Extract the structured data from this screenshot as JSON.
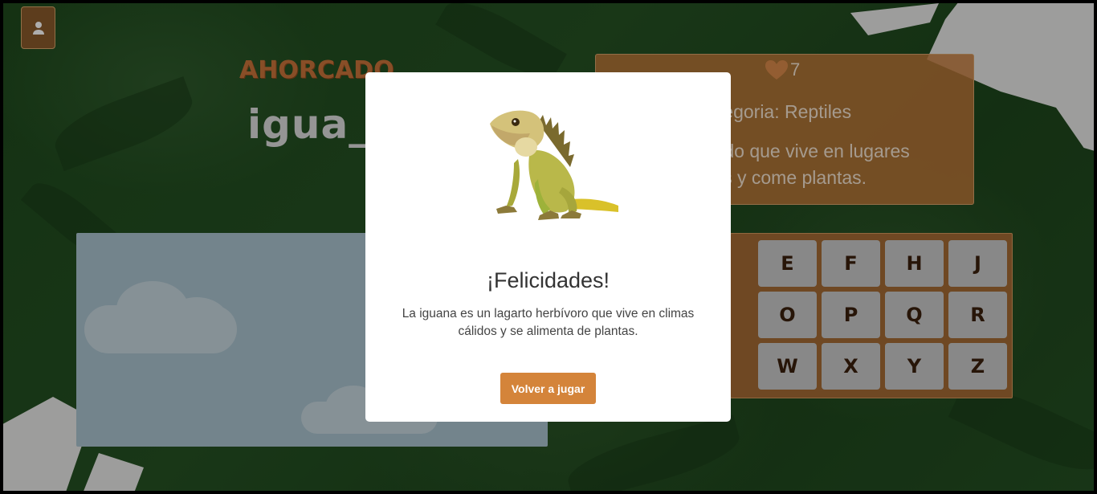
{
  "game": {
    "title": "AHORCADO",
    "word_display": "igua_a",
    "lives": "7",
    "category": "tegoria: Reptiles",
    "hint_line1": "o colorido que vive en lugares",
    "hint_line2": "tes y come plantas.",
    "keys": [
      "E",
      "F",
      "H",
      "J",
      "O",
      "P",
      "Q",
      "R",
      "W",
      "X",
      "Y",
      "Z"
    ]
  },
  "modal": {
    "image_icon": "iguana-image",
    "title": "¡Felicidades!",
    "message": "La iguana es un lagarto herbívoro que vive en climas cálidos y se alimenta de plantas.",
    "button_label": "Volver a jugar"
  },
  "colors": {
    "accent": "#d4843a",
    "title_color": "#c9743a",
    "background": "#244f22"
  },
  "icons": {
    "user": "user-icon",
    "heart": "heart-icon"
  }
}
